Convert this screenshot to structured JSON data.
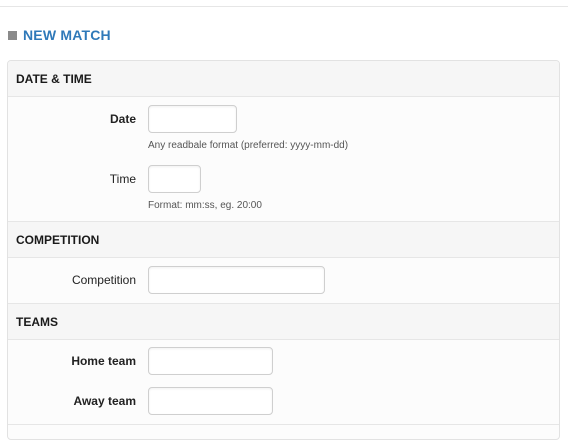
{
  "header": {
    "title": "NEW MATCH"
  },
  "sections": {
    "datetime": {
      "title": "DATE & TIME",
      "date": {
        "label": "Date",
        "value": "",
        "help": "Any readbale format (preferred: yyyy-mm-dd)"
      },
      "time": {
        "label": "Time",
        "value": "",
        "help": "Format: mm:ss, eg. 20:00"
      }
    },
    "competition": {
      "title": "COMPETITION",
      "competition": {
        "label": "Competition",
        "value": ""
      }
    },
    "teams": {
      "title": "TEAMS",
      "home": {
        "label": "Home team",
        "value": ""
      },
      "away": {
        "label": "Away team",
        "value": ""
      }
    }
  },
  "colors": {
    "title": "#2f79b9",
    "bullet": "#8a8a8a",
    "section_bg": "#f6f6f6",
    "input_border": "#cfcfcf"
  }
}
